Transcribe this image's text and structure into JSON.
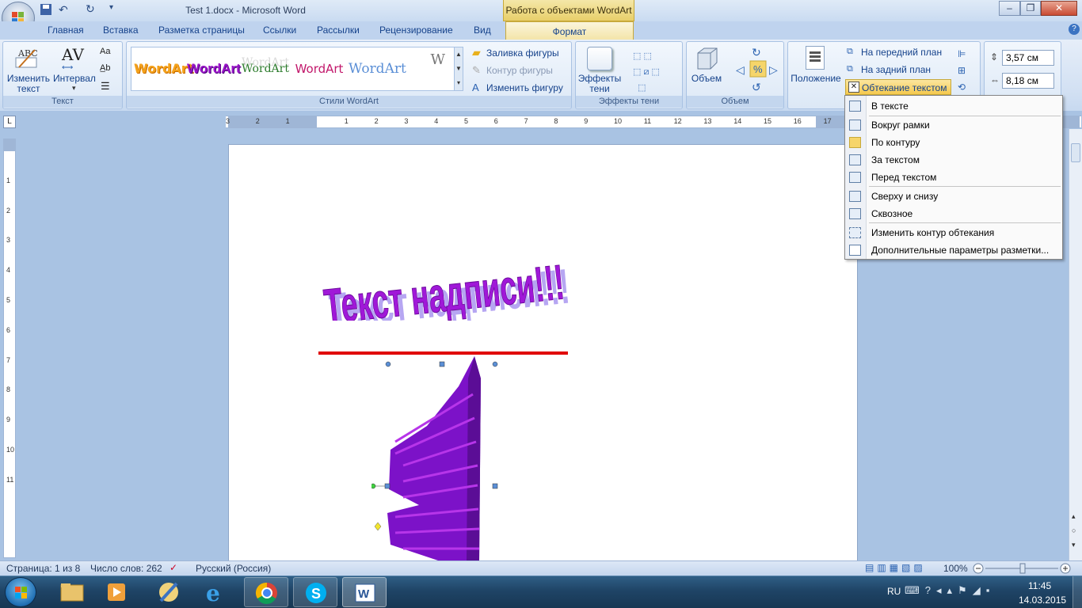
{
  "window": {
    "title": "Test 1.docx - Microsoft Word",
    "context_title": "Работа с объектами WordArt"
  },
  "tabs": [
    "Главная",
    "Вставка",
    "Разметка страницы",
    "Ссылки",
    "Рассылки",
    "Рецензирование",
    "Вид",
    "Формат"
  ],
  "groups": {
    "text": {
      "label": "Текст",
      "edit_text": "Изменить текст",
      "spacing": "Интервал"
    },
    "styles": {
      "label": "Стили WordArt",
      "samples": [
        "WordArt",
        "WordArt",
        "WordArt",
        "WordArt",
        "WordArt",
        "W"
      ],
      "fill": "Заливка фигуры",
      "outline": "Контур фигуры",
      "change": "Изменить фигуру"
    },
    "shadow": {
      "label": "Эффекты тени",
      "button": "Эффекты тени"
    },
    "volume": {
      "label": "Объем",
      "button": "Объем"
    },
    "arrange": {
      "position": "Положение",
      "front": "На передний план",
      "back": "На задний план",
      "wrap": "Обтекание текстом"
    },
    "size": {
      "height": "3,57 см",
      "width": "8,18 см"
    }
  },
  "wrap_menu": [
    "В тексте",
    "Вокруг рамки",
    "По контуру",
    "За текстом",
    "Перед текстом",
    "Сверху и снизу",
    "Сквозное",
    "Изменить контур обтекания",
    "Дополнительные параметры разметки..."
  ],
  "document": {
    "wordart_text": "Текст надписи!!!"
  },
  "ruler": {
    "labels": [
      "3",
      "2",
      "1",
      "1",
      "2",
      "3",
      "4",
      "5",
      "6",
      "7",
      "8",
      "9",
      "10",
      "11",
      "12",
      "13",
      "14",
      "15",
      "16",
      "17"
    ]
  },
  "status": {
    "page": "Страница: 1 из 8",
    "words": "Число слов: 262",
    "lang": "Русский (Россия)",
    "zoom": "100%"
  },
  "tray": {
    "lang": "RU",
    "time": "11:45",
    "date": "14.03.2015"
  },
  "colors": {
    "wordart": "#9a0fd3",
    "accent": "#f3d55b",
    "underline": "#e00000"
  }
}
